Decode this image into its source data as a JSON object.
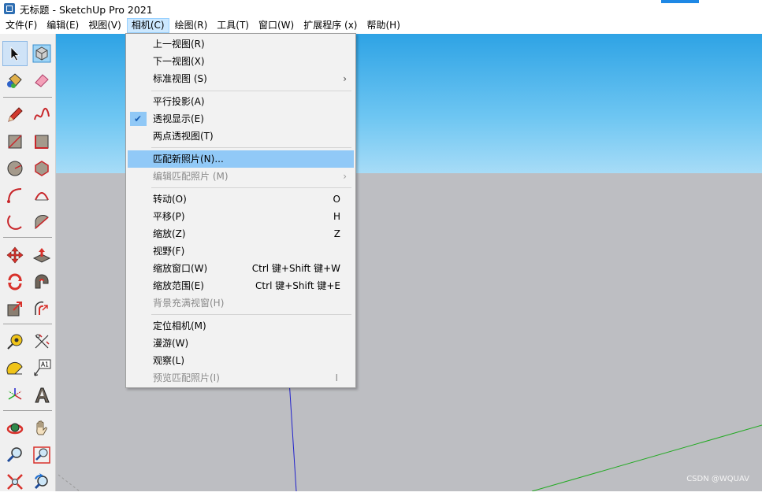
{
  "window": {
    "title": "无标题 - SketchUp Pro 2021"
  },
  "menubar": [
    {
      "label": "文件(F)"
    },
    {
      "label": "编辑(E)"
    },
    {
      "label": "视图(V)"
    },
    {
      "label": "相机(C)"
    },
    {
      "label": "绘图(R)"
    },
    {
      "label": "工具(T)"
    },
    {
      "label": "窗口(W)"
    },
    {
      "label": "扩展程序 (x)"
    },
    {
      "label": "帮助(H)"
    }
  ],
  "camera_menu": {
    "previous_view": "上一视图(R)",
    "next_view": "下一视图(X)",
    "standard_views": "标准视图 (S)",
    "parallel_projection": "平行投影(A)",
    "perspective": "透视显示(E)",
    "two_point_perspective": "两点透视图(T)",
    "match_new_photo": "匹配新照片(N)...",
    "edit_matched_photo": "编辑匹配照片 (M)",
    "orbit": "转动(O)",
    "orbit_shortcut": "O",
    "pan": "平移(P)",
    "pan_shortcut": "H",
    "zoom": "缩放(Z)",
    "zoom_shortcut": "Z",
    "field_of_view": "视野(F)",
    "zoom_window": "缩放窗口(W)",
    "zoom_window_shortcut": "Ctrl 键+Shift 键+W",
    "zoom_extents": "缩放范围(E)",
    "zoom_extents_shortcut": "Ctrl 键+Shift 键+E",
    "zoom_to_photo": "背景充满视窗(H)",
    "position_camera": "定位相机(M)",
    "walk": "漫游(W)",
    "look_around": "观察(L)",
    "preview_matched_photo": "预览匹配照片(I)",
    "preview_matched_photo_shortcut": "I",
    "arrow_glyph": "›",
    "check_glyph": "✔"
  },
  "toolbar": {
    "text_tool_glyph": "A1",
    "tools": [
      {
        "name": "select-tool",
        "icon": "arrow-cursor-icon"
      },
      {
        "name": "make-component-tool",
        "icon": "component-cube-icon"
      },
      {
        "name": "paint-bucket-tool",
        "icon": "paint-bucket-icon"
      },
      {
        "name": "eraser-tool",
        "icon": "eraser-icon"
      },
      {
        "name": "line-tool",
        "icon": "pencil-icon"
      },
      {
        "name": "freehand-tool",
        "icon": "freehand-curve-icon"
      },
      {
        "name": "rectangle-tool",
        "icon": "rectangle-icon"
      },
      {
        "name": "rotated-rectangle-tool",
        "icon": "rotated-rectangle-icon"
      },
      {
        "name": "circle-tool",
        "icon": "circle-icon"
      },
      {
        "name": "polygon-tool",
        "icon": "polygon-icon"
      },
      {
        "name": "arc-tool",
        "icon": "arc-icon"
      },
      {
        "name": "two-point-arc-tool",
        "icon": "two-point-arc-icon"
      },
      {
        "name": "three-point-arc-tool",
        "icon": "three-point-arc-icon"
      },
      {
        "name": "pie-tool",
        "icon": "pie-icon"
      },
      {
        "name": "move-tool",
        "icon": "move-arrows-icon"
      },
      {
        "name": "push-pull-tool",
        "icon": "push-pull-icon"
      },
      {
        "name": "rotate-tool",
        "icon": "rotate-icon"
      },
      {
        "name": "follow-me-tool",
        "icon": "follow-me-icon"
      },
      {
        "name": "scale-tool",
        "icon": "scale-icon"
      },
      {
        "name": "offset-tool",
        "icon": "offset-icon"
      },
      {
        "name": "tape-measure-tool",
        "icon": "tape-measure-icon"
      },
      {
        "name": "dimension-tool",
        "icon": "dimension-icon"
      },
      {
        "name": "protractor-tool",
        "icon": "protractor-icon"
      },
      {
        "name": "text-tool",
        "icon": "text-label-icon"
      },
      {
        "name": "axes-tool",
        "icon": "axes-icon"
      },
      {
        "name": "3d-text-tool",
        "icon": "3d-text-icon"
      },
      {
        "name": "orbit-tool",
        "icon": "orbit-icon"
      },
      {
        "name": "pan-tool",
        "icon": "hand-icon"
      },
      {
        "name": "zoom-tool",
        "icon": "magnifier-icon"
      },
      {
        "name": "zoom-window-tool",
        "icon": "zoom-window-icon"
      },
      {
        "name": "zoom-extents-tool",
        "icon": "zoom-extents-icon"
      },
      {
        "name": "previous-view-tool",
        "icon": "previous-view-icon"
      }
    ]
  },
  "watermark": "CSDN @WQUAV",
  "colors": {
    "sky_top": "#2ea3e5",
    "ground": "#bdbec2",
    "menu_highlight": "#91c9f7",
    "axis_blue": "#2222cc",
    "axis_green": "#22aa22"
  }
}
